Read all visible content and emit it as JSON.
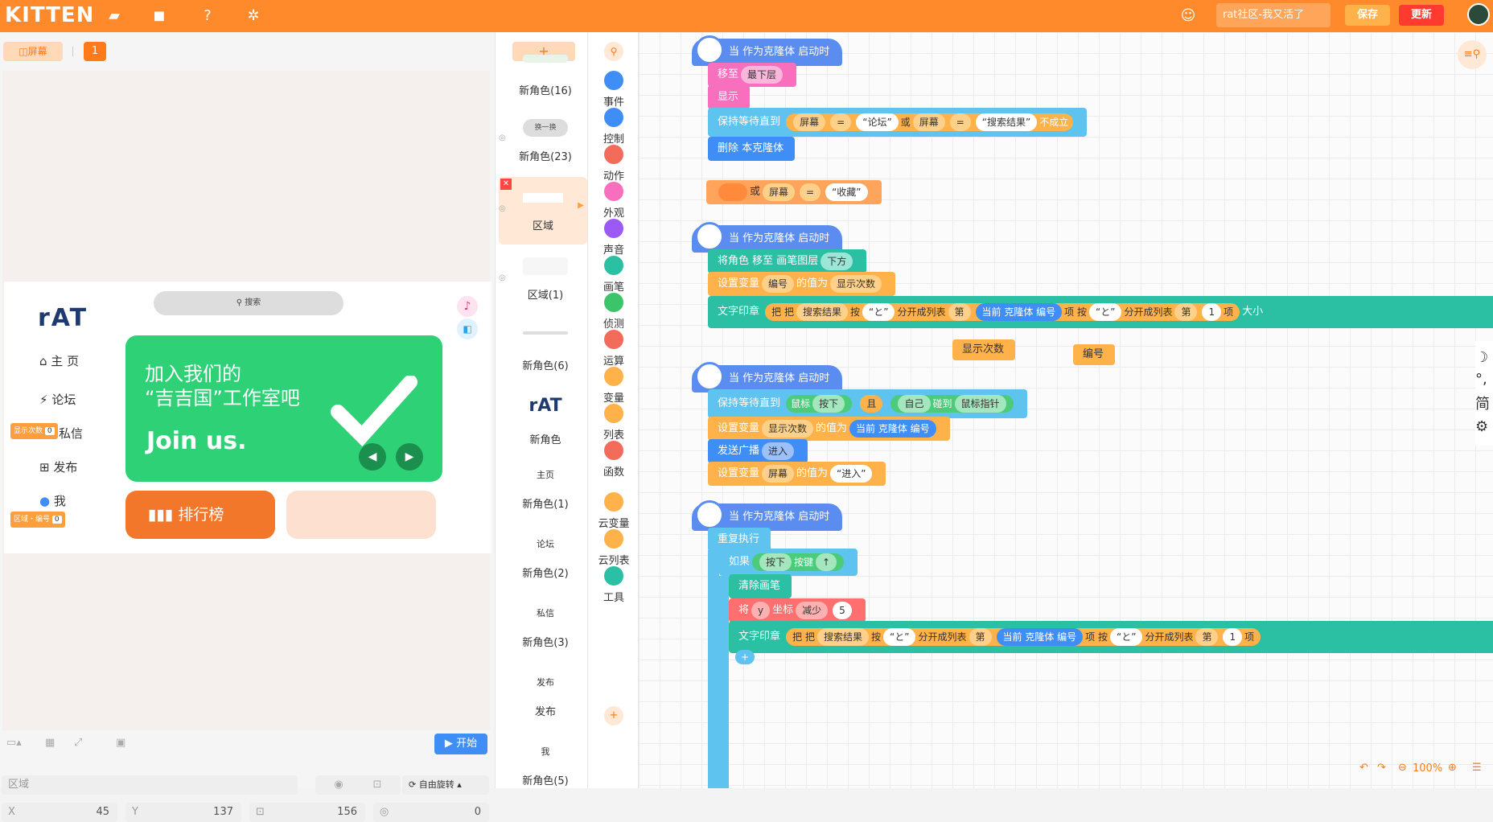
{
  "app": {
    "logo": "KITTEN",
    "project_name": "rat社区-我又活了",
    "save_label": "保存",
    "update_label": "更新"
  },
  "toolbar_icons": [
    "folder-icon",
    "bag-icon",
    "help-icon",
    "gear-icon"
  ],
  "stage": {
    "tab_label": "屏幕",
    "tab_prefix": "◫",
    "page_number": "1",
    "canvas": {
      "search_label": "搜索",
      "logo": "rAT",
      "nav": [
        "主 页",
        "论坛",
        "私信",
        "发布",
        "我"
      ],
      "var_display_count_label": "显示次数",
      "var_display_count_value": "0",
      "var_area_label": "区域・编号",
      "var_area_value": "0",
      "banner_line1": "加入我们的",
      "banner_line2": "“吉吉国”工作室吧",
      "banner_line3": "Join us.",
      "ranking_label": "排行榜"
    },
    "start_label": "开始"
  },
  "props": {
    "name_value": "区域",
    "rotate_label": "自由旋转",
    "x_label": "X",
    "x_value": "45",
    "y_label": "Y",
    "y_value": "137",
    "size_value": "156",
    "dir_value": "0"
  },
  "sprites": {
    "add_label": "+",
    "items": [
      {
        "label": "新角色(16)"
      },
      {
        "label": "新角色(23)",
        "thumb": "换一换"
      },
      {
        "label": "区域"
      },
      {
        "label": "区域(1)"
      },
      {
        "label": "新角色(6)"
      },
      {
        "label": "新角色",
        "thumb": "rAT"
      },
      {
        "label": "新角色(1)",
        "thumb": "主页"
      },
      {
        "label": "新角色(2)",
        "thumb": "论坛"
      },
      {
        "label": "新角色(3)",
        "thumb": "私信"
      },
      {
        "label": "发布",
        "thumb": "发布"
      },
      {
        "label": "新角色(5)",
        "thumb": "我"
      }
    ]
  },
  "categories": [
    {
      "label": "事件",
      "color": "#3f8ef5"
    },
    {
      "label": "控制",
      "color": "#3f8ef5"
    },
    {
      "label": "动作",
      "color": "#f26b5b"
    },
    {
      "label": "外观",
      "color": "#f76fbd"
    },
    {
      "label": "声音",
      "color": "#9b59f5"
    },
    {
      "label": "画笔",
      "color": "#2bbfa4"
    },
    {
      "label": "侦测",
      "color": "#3cc46b"
    },
    {
      "label": "运算",
      "color": "#f26b5b"
    },
    {
      "label": "变量",
      "color": "#ffb14a"
    },
    {
      "label": "列表",
      "color": "#ffb14a"
    },
    {
      "label": "函数",
      "color": "#f26b5b"
    },
    {
      "label": "云变量",
      "color": "#ffb14a"
    },
    {
      "label": "云列表",
      "color": "#ffb14a"
    },
    {
      "label": "工具",
      "color": "#2bbfa4"
    }
  ],
  "code": {
    "s1_hat": "当 作为克隆体 启动时",
    "s1_b1": "移至",
    "s1_b1_opt": "最下层",
    "s1_b2": "显示",
    "s1_b3": "保持等待直到",
    "s1_b3_a": "屏幕",
    "s1_b3_eq": "=",
    "s1_b3_s1": "“论坛”",
    "s1_b3_or": "或",
    "s1_b3_b": "屏幕",
    "s1_b3_eq2": "=",
    "s1_b3_s2": "“搜索结果”",
    "s1_b3_not": "不成立",
    "s1_b4": "删除 本克隆体",
    "loose_or": "或",
    "loose_a": "屏幕",
    "loose_eq": "=",
    "loose_s": "“收藏”",
    "s2_hat": "当 作为克隆体 启动时",
    "s2_b1": "将角色 移至 画笔图层",
    "s2_b1_opt": "下方",
    "s2_b2": "设置变量",
    "s2_b2_var": "编号",
    "s2_b2_mid": "的值为",
    "s2_b2_val": "显示次数",
    "s2_b3": "文字印章",
    "s2_b3_a": "把",
    "s2_b3_b": "把",
    "s2_b3_list": "搜索结果",
    "s2_b3_by": "按",
    "s2_b3_sep": "“と”",
    "s2_b3_split": "分开成列表",
    "s2_b3_nth": "第",
    "s2_b3_idx": "当前 克隆体 编号",
    "s2_b3_item": "项",
    "s2_b3_by2": "按",
    "s2_b3_sep2": "“と”",
    "s2_b3_split2": "分开成列表",
    "s2_b3_nth2": "第",
    "s2_b3_one": "1",
    "s2_b3_item2": "项",
    "s2_b3_size": "大小",
    "loose_var1": "显示次数",
    "loose_var2": "编号",
    "s3_hat": "当 作为克隆体 启动时",
    "s3_b1": "保持等待直到",
    "s3_b1_mouse": "鼠标",
    "s3_b1_press": "按下",
    "s3_b1_and": "且",
    "s3_b1_self": "自己",
    "s3_b1_touch": "碰到",
    "s3_b1_ptr": "鼠标指针",
    "s3_b2": "设置变量",
    "s3_b2_var": "显示次数",
    "s3_b2_mid": "的值为",
    "s3_b2_val": "当前 克隆体 编号",
    "s3_b3": "发送广播",
    "s3_b3_msg": "进入",
    "s3_b4": "设置变量",
    "s3_b4_var": "屏幕",
    "s3_b4_mid": "的值为",
    "s3_b4_val": "“进入”",
    "s4_hat": "当 作为克隆体 启动时",
    "s4_b1": "重复执行",
    "s4_b2": "如果",
    "s4_b2_press": "按下",
    "s4_b2_key": "按键",
    "s4_b2_arrow": "↑",
    "s4_b3": "清除画笔",
    "s4_b4": "将",
    "s4_b4_y": "y",
    "s4_b4_coord": "坐标",
    "s4_b4_dec": "减少",
    "s4_b4_val": "5",
    "s4_b5": "文字印章",
    "s4_b5_a": "把",
    "s4_b5_b": "把",
    "s4_b5_list": "搜索结果",
    "s4_b5_by": "按",
    "s4_b5_sep": "“と”",
    "s4_b5_split": "分开成列表",
    "s4_b5_nth": "第",
    "s4_b5_idx": "当前 克隆体 编号",
    "s4_b5_item": "项",
    "s4_b5_by2": "按",
    "s4_b5_sep2": "“と”",
    "s4_b5_split2": "分开成列表",
    "s4_b5_nth2": "第",
    "s4_b5_one": "1",
    "s4_b5_item2": "项"
  },
  "zoom": {
    "level": "100%"
  },
  "side_tools": [
    "☽",
    "°,",
    "简",
    "⚙"
  ]
}
